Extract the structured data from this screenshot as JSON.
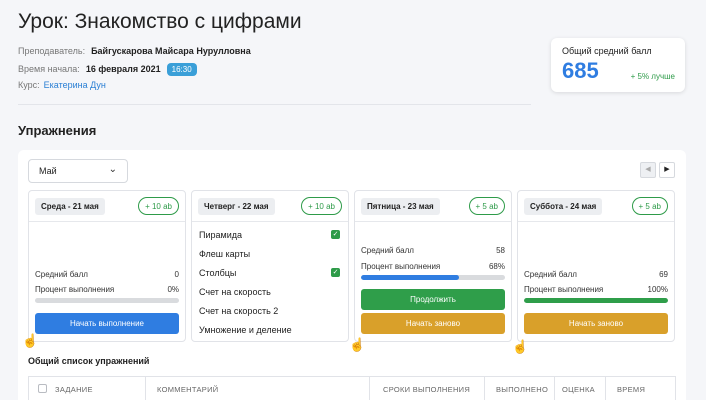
{
  "lesson": {
    "title": "Урок: Знакомство с цифрами",
    "teacher_label": "Преподаватель:",
    "teacher_name": "Байгускарова Майсара Нурулловна",
    "start_label": "Время начала:",
    "start_date": "16 февраля 2021",
    "start_time": "16:30",
    "course_label": "Курс:",
    "course_name": "Екатерина Дун"
  },
  "score": {
    "label": "Общий средний балл",
    "value": "685",
    "delta": "+ 5% лучше"
  },
  "exercises": {
    "section_title": "Упражнения",
    "month_select": "Май",
    "icons": {
      "dropdown": "chevron-down-icon",
      "prev": "triangle-left-icon",
      "next": "triangle-right-icon",
      "cursor": "hand-pointer-icon"
    }
  },
  "days": [
    {
      "date": "Среда - 21 мая",
      "badge": "+ 10 ab",
      "avg_label": "Средний балл",
      "avg_value": "0",
      "progress_label": "Процент выполнения",
      "progress_value": "0%",
      "progress": 0,
      "button": "Начать выполнение"
    },
    {
      "date": "Четверг - 22 мая",
      "badge": "+ 10 ab",
      "items": [
        {
          "label": "Пирамида",
          "checked": true
        },
        {
          "label": "Флеш карты",
          "checked": false
        },
        {
          "label": "Столбцы",
          "checked": true
        },
        {
          "label": "Счет на скорость",
          "checked": false
        },
        {
          "label": "Счет на скорость 2",
          "checked": false
        },
        {
          "label": "Умножение и деление",
          "checked": false
        }
      ]
    },
    {
      "date": "Пятница - 23 мая",
      "badge": "+ 5 ab",
      "avg_label": "Средний балл",
      "avg_value": "58",
      "progress_label": "Процент выполнения",
      "progress_value": "68%",
      "progress": 0.68,
      "button_continue": "Продолжить",
      "button_restart": "Начать заново"
    },
    {
      "date": "Суббота - 24 мая",
      "badge": "+ 5 ab",
      "avg_label": "Средний балл",
      "avg_value": "69",
      "progress_label": "Процент выполнения",
      "progress_value": "100%",
      "progress": 1,
      "button_restart": "Начать заново"
    }
  ],
  "table": {
    "title": "Общий список упражнений",
    "columns": [
      "ЗАДАНИЕ",
      "КОММЕНТАРИЙ",
      "СРОКИ ВЫПОЛНЕНИЯ",
      "ВЫПОЛНЕНО",
      "ОЦЕНКА",
      "ВРЕМЯ"
    ]
  },
  "colors": {
    "accent_blue": "#2f7de1",
    "green": "#2e9b49",
    "orange": "#d9a02a",
    "time_badge": "#3a9fd8"
  }
}
